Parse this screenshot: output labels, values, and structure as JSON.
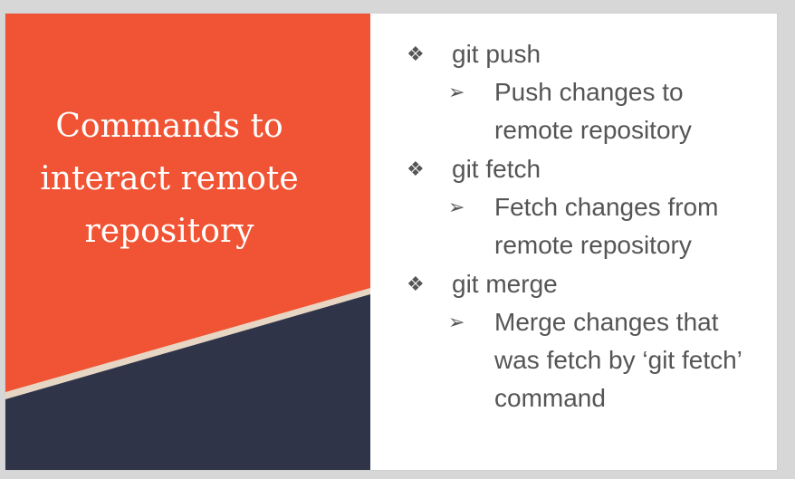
{
  "slide": {
    "title_lines": [
      "Commands to",
      "interact remote",
      "repository"
    ],
    "colors": {
      "orange": "#f05434",
      "navy": "#2f3448",
      "beige": "#e7d6c4",
      "text": "#555555",
      "white": "#ffffff"
    },
    "bullets": [
      {
        "icon": "diamond-bullet-icon",
        "glyph": "❖",
        "label": "git push",
        "sub_icon": "arrow-bullet-icon",
        "sub_glyph": "➢",
        "sub_lines": [
          "Push changes to",
          "remote repository"
        ]
      },
      {
        "icon": "diamond-bullet-icon",
        "glyph": "❖",
        "label": "git fetch",
        "sub_icon": "arrow-bullet-icon",
        "sub_glyph": "➢",
        "sub_lines": [
          "Fetch changes from",
          "remote repository"
        ]
      },
      {
        "icon": "diamond-bullet-icon",
        "glyph": "❖",
        "label": "git merge",
        "sub_icon": "arrow-bullet-icon",
        "sub_glyph": "➢",
        "sub_lines": [
          "Merge changes that",
          "was fetch by ‘git fetch’",
          "command"
        ]
      }
    ]
  }
}
